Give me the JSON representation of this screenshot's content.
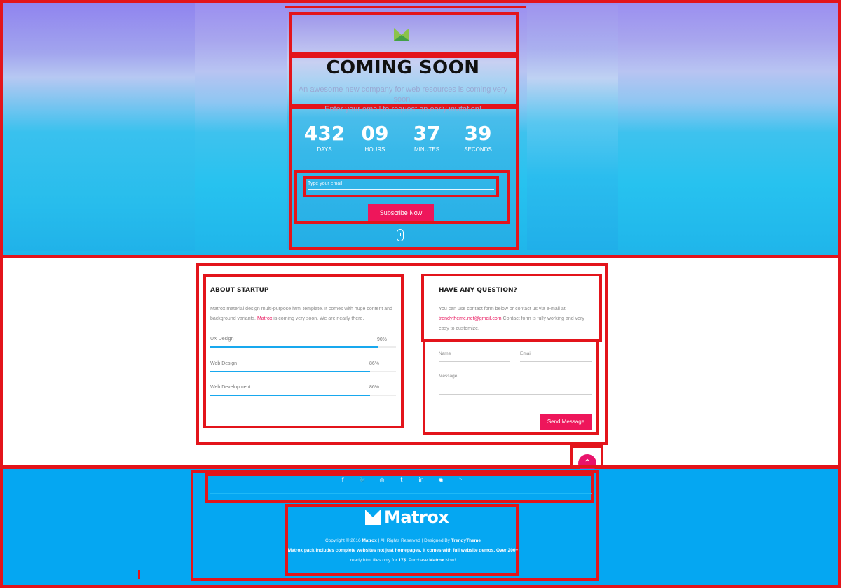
{
  "page": {
    "hero": {
      "logo_icon": "matrox-logo-icon",
      "title": "COMING SOON",
      "subtitle_line1": "An awesome new company for web resources is coming very soon.",
      "subtitle_line2": "Enter your email to request an early invitation!",
      "countdown": [
        {
          "value": "432",
          "label": "DAYS"
        },
        {
          "value": "09",
          "label": "HOURS"
        },
        {
          "value": "37",
          "label": "MINUTES"
        },
        {
          "value": "39",
          "label": "SECONDS"
        }
      ],
      "email_placeholder": "Type your email",
      "subscribe_label": "Subscribe Now",
      "scroll_icon": "mouse-scroll-icon"
    },
    "about": {
      "title": "ABOUT STARTUP",
      "text_part1": "Matrox material design multi-purpose html template. It comes with huge content",
      "text_part2": "and background variants.",
      "highlight": "Matrox",
      "text_part3": "is coming very soon. We are nearly there.",
      "skills": [
        {
          "label": "UX Design",
          "percent_text": "90%",
          "percent": 90
        },
        {
          "label": "Web Design",
          "percent_text": "86%",
          "percent": 86
        },
        {
          "label": "Web Development",
          "percent_text": "86%",
          "percent": 86
        }
      ]
    },
    "contact": {
      "title": "HAVE ANY QUESTION?",
      "text_part1": "You can use contact form below or contact us via e-mail at",
      "email": "trendytheme.net@gmail.com",
      "text_part2": "Contact form is fully working and very",
      "text_part3": "easy to customize.",
      "name_label": "Name",
      "email_label": "Email",
      "message_label": "Message",
      "send_label": "Send Message"
    },
    "back_to_top_icon": "chevron-up-icon",
    "footer": {
      "social_icons": [
        "facebook-icon",
        "twitter-icon",
        "dribbble-icon",
        "tumblr-icon",
        "linkedin-icon",
        "instagram-icon",
        "rss-icon"
      ],
      "social_glyphs": [
        "f",
        "🐦",
        "◎",
        "t",
        "in",
        "◉",
        "◝"
      ],
      "brand": "Matrox",
      "copyright_prefix": "Copyright © 2016",
      "copyright_brand": "Matrox",
      "copyright_rights": "All Rights Reserved",
      "designed_by_label": "Designed By",
      "designed_by_name": "TrendyTheme",
      "pack_part1": "Matrox pack includes complete websites not just homepages, it comes with full website demos. Over",
      "pack_count": "200+",
      "pack_part2": "ready html files only for",
      "pack_price": "17$",
      "pack_part3": "Purchase",
      "pack_brand": "Matrox",
      "pack_part4": "Now!"
    }
  }
}
